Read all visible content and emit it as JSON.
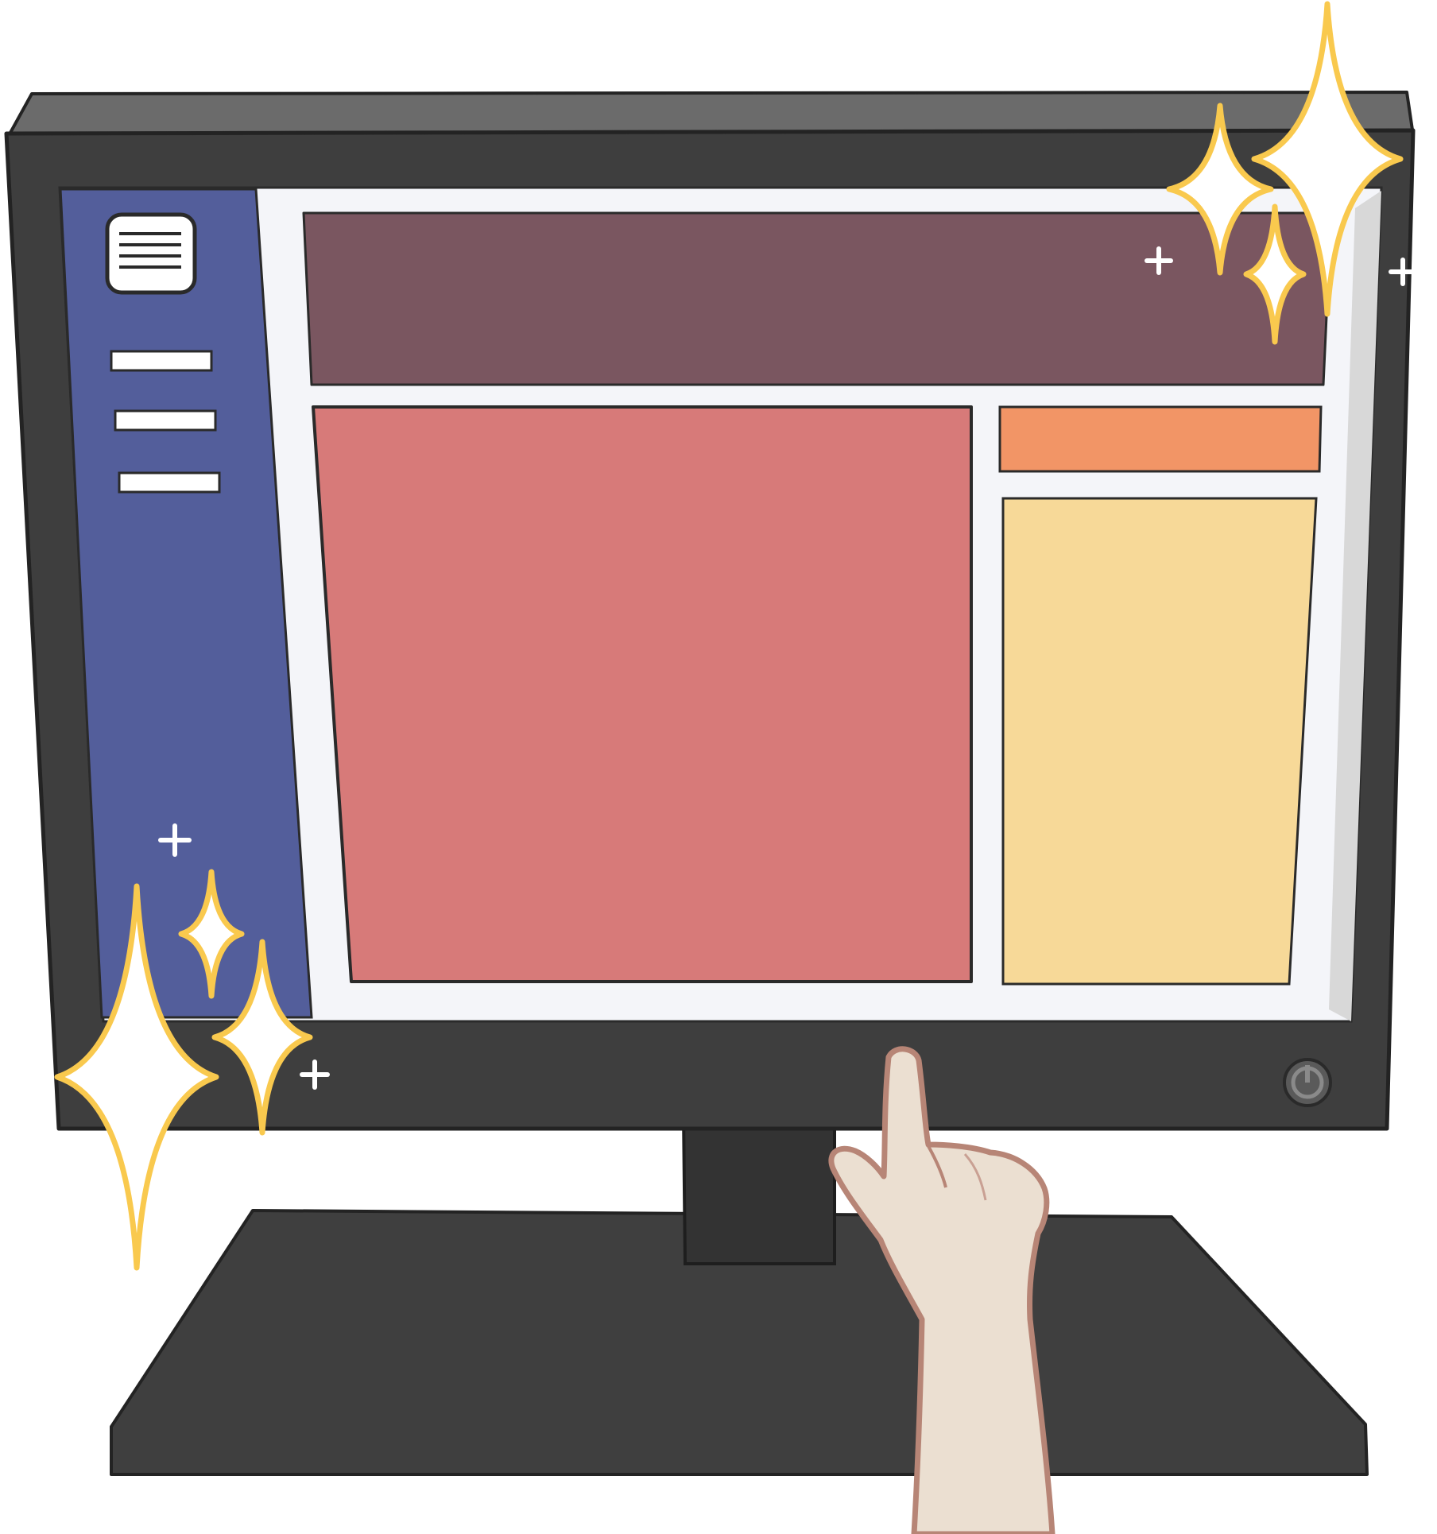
{
  "colors": {
    "background": "#ffffff",
    "monitor_top_edge": "#6b6b6b",
    "monitor_bezel": "#3e3e3e",
    "bezel_outline": "#232323",
    "stand": "#333333",
    "base": "#3f3f3f",
    "screen_bg": "#f4f5f9",
    "screen_shadow": "#d8d8d8",
    "sidebar": "#535e9b",
    "sidebar_lines": "#ffffff",
    "header_panel": "#7a5660",
    "main_panel": "#d77a79",
    "side_header_panel": "#f29566",
    "side_panel": "#f7d998",
    "sparkle_fill": "#ffffff",
    "sparkle_stroke": "#f9c94e",
    "plus_mark": "#ffffff",
    "power_button": "#6a6a6a",
    "hand_skin": "#ebdfd1",
    "hand_outline": "#b78576"
  },
  "icons": {
    "sidebar_menu": "hamburger-menu-icon",
    "power": "power-icon",
    "sparkle": "sparkle-icon",
    "plus": "plus-icon",
    "pointer_hand": "pointing-hand"
  },
  "sidebar": {
    "item_count": 3
  }
}
